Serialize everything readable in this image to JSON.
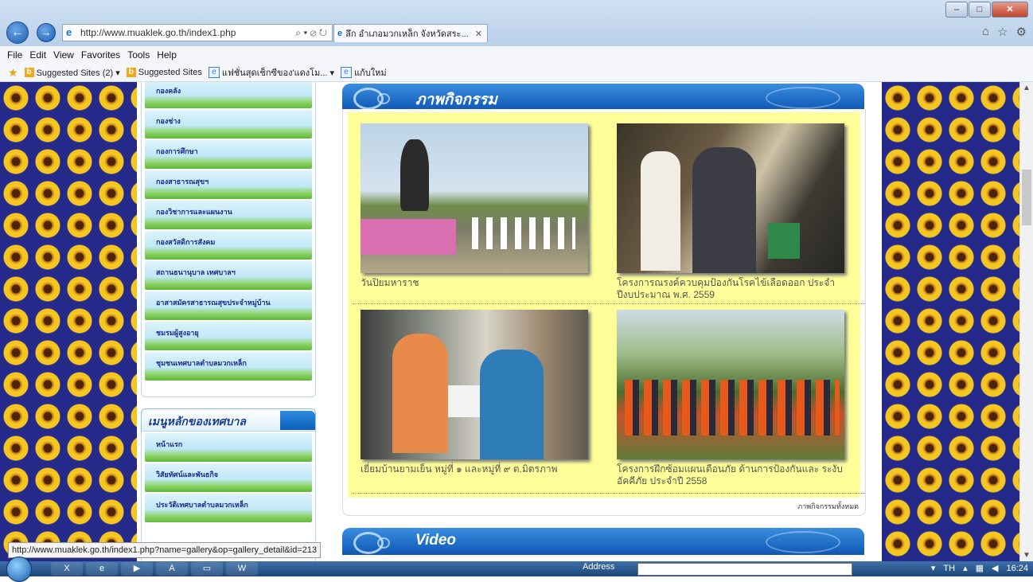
{
  "browser": {
    "url": "http://www.muaklek.go.th/index1.php",
    "tab_title": "ลึก อำเภอมวกเหล็ก จังหวัดสระ...",
    "menu": [
      "File",
      "Edit",
      "View",
      "Favorites",
      "Tools",
      "Help"
    ],
    "favorites": [
      {
        "label": "Suggested Sites (2) ▾",
        "icon": "bing-icon"
      },
      {
        "label": "Suggested Sites",
        "icon": "bing-icon"
      },
      {
        "label": "แฟชั่นสุดเช็กซีของ'แดงโม... ▾",
        "icon": "ie-page-icon"
      },
      {
        "label": "แก้บใหม่",
        "icon": "ie-page-icon"
      }
    ]
  },
  "sidebar": {
    "top_items": [
      "กองคลัง",
      "กองช่าง",
      "กองการศึกษา",
      "กองสาธารณสุขฯ",
      "กองวิชาการและแผนงาน",
      "กองสวัสดิการสังคม",
      "สถานธนานุบาล เทศบาลฯ",
      "อาสาสมัครสาธารณสุขประจำหมู่บ้าน",
      "ชมรมผู้สูงอายุ",
      "ชุมชนเทศบาลตำบลมวกเหล็ก"
    ],
    "menu_heading": "เมนูหลักของเทศบาล",
    "menu_items": [
      "หน้าแรก",
      "วิสัยทัศน์และพันธกิจ",
      "ประวัติเทศบาลตำบลมวกเหล็ก"
    ]
  },
  "gallery": {
    "heading": "ภาพกิจกรรม",
    "items": [
      {
        "caption": "วันปิยมหาราช"
      },
      {
        "caption": "โครงการณรงค์ควบคุมป้องกันโรคไข้เลือดออก ประจำปีงบประมาณ พ.ศ. 2559"
      },
      {
        "caption": "เยี่ยมบ้านยามเย็น หมู่ที่ ๑ และหมู่ที่ ๙ ต.มิตรภาพ"
      },
      {
        "caption": "โครงการฝึกซ้อมแผนเตือนภัย ด้านการป้องกันและ ระงับอัคคีภัย ประจำปี 2558"
      }
    ],
    "all_link": "ภาพกิจกรรมทั้งหมด"
  },
  "video": {
    "heading": "Video"
  },
  "status_url": "http://www.muaklek.go.th/index1.php?name=gallery&op=gallery_detail&id=213",
  "taskbar": {
    "address_label": "Address",
    "language": "TH",
    "clock": "16:24"
  }
}
